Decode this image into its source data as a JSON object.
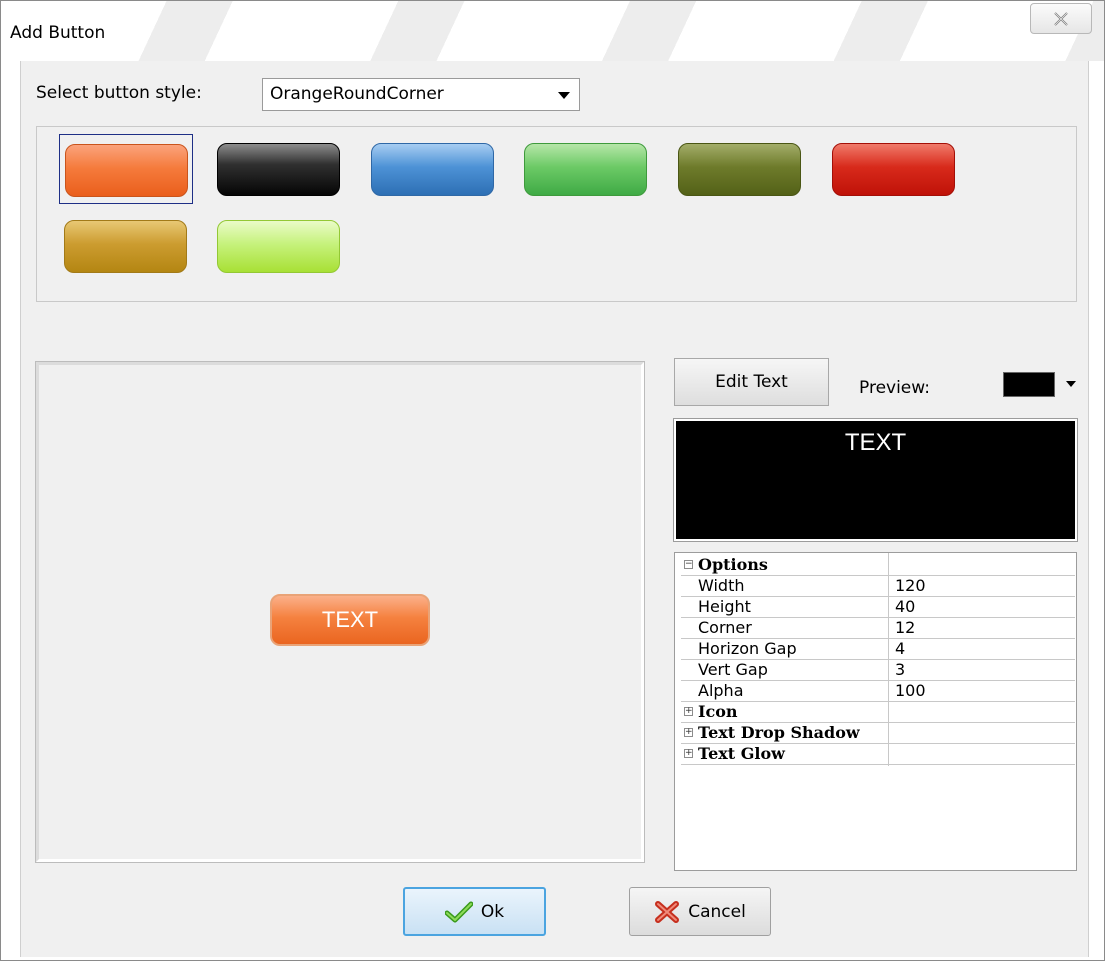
{
  "window": {
    "title": "Add Button"
  },
  "style_selector": {
    "label": "Select button style:",
    "selected": "OrangeRoundCorner"
  },
  "gallery": {
    "selected_index": 0,
    "swatches": [
      {
        "name": "orange",
        "color": "#f57b3c"
      },
      {
        "name": "black",
        "color": "#1a1a1a"
      },
      {
        "name": "blue",
        "color": "#4d92d6"
      },
      {
        "name": "green",
        "color": "#6cca66"
      },
      {
        "name": "olive",
        "color": "#6e7b2b"
      },
      {
        "name": "red",
        "color": "#d82a1b"
      },
      {
        "name": "gold",
        "color": "#cc9c30"
      },
      {
        "name": "lime",
        "color": "#c6f27c"
      }
    ]
  },
  "canvas": {
    "button_text": "TEXT"
  },
  "text_editor": {
    "edit_label": "Edit Text",
    "preview_label": "Preview:",
    "preview_color": "#000000",
    "preview_text": "TEXT"
  },
  "options": {
    "category_options": "Options",
    "rows": [
      {
        "name": "Width",
        "value": "120"
      },
      {
        "name": "Height",
        "value": "40"
      },
      {
        "name": "Corner",
        "value": "12"
      },
      {
        "name": "Horizon Gap",
        "value": "4"
      },
      {
        "name": "Vert Gap",
        "value": "3"
      },
      {
        "name": "Alpha",
        "value": "100"
      }
    ],
    "collapsed_categories": [
      "Icon",
      "Text Drop Shadow",
      "Text Glow"
    ]
  },
  "footer": {
    "ok_label": "Ok",
    "cancel_label": "Cancel"
  }
}
